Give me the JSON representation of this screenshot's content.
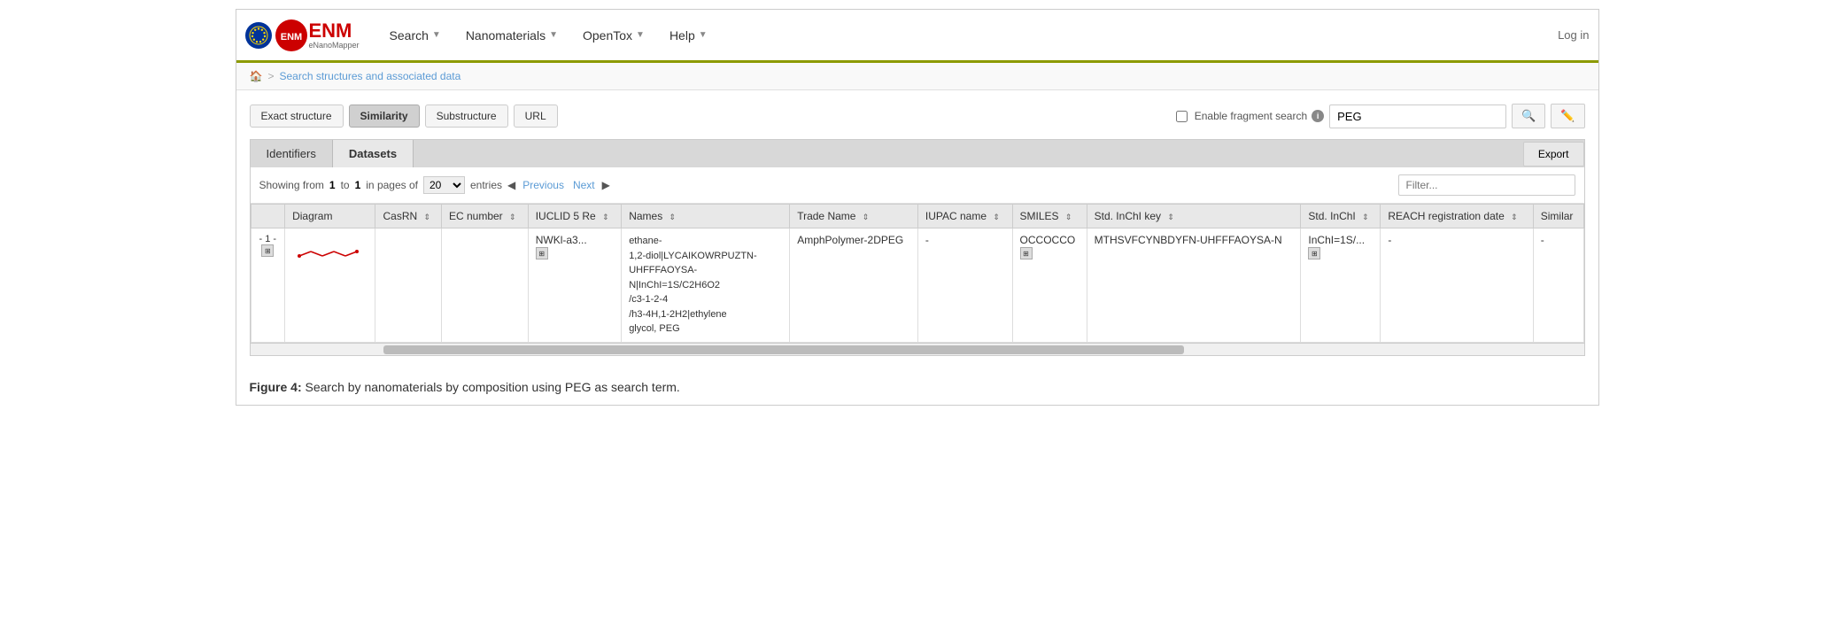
{
  "app": {
    "title": "eNanoMapper",
    "login_label": "Log in"
  },
  "navbar": {
    "items": [
      {
        "id": "search",
        "label": "Search",
        "has_dropdown": true
      },
      {
        "id": "nanomaterials",
        "label": "Nanomaterials",
        "has_dropdown": true
      },
      {
        "id": "opentox",
        "label": "OpenTox",
        "has_dropdown": true
      },
      {
        "id": "help",
        "label": "Help",
        "has_dropdown": true
      }
    ]
  },
  "breadcrumb": {
    "home_icon": "🏠",
    "separator": ">",
    "link_label": "Search structures and associated data"
  },
  "search_tabs": [
    {
      "id": "exact",
      "label": "Exact structure",
      "active": false
    },
    {
      "id": "similarity",
      "label": "Similarity",
      "active": true
    },
    {
      "id": "substructure",
      "label": "Substructure",
      "active": false
    },
    {
      "id": "url",
      "label": "URL",
      "active": false
    }
  ],
  "fragment_search": {
    "label": "Enable fragment search",
    "info_icon": "i",
    "search_value": "PEG",
    "search_placeholder": "PEG"
  },
  "id_tabs": [
    {
      "id": "identifiers",
      "label": "Identifiers",
      "active": false
    },
    {
      "id": "datasets",
      "label": "Datasets",
      "active": true
    }
  ],
  "export_label": "Export",
  "entries": {
    "showing_prefix": "Showing from",
    "from": "1",
    "to_text": "to",
    "to": "1",
    "pages_text": "in pages of",
    "page_size": "20",
    "entries_text": "entries",
    "prev_label": "Previous",
    "next_label": "Next",
    "filter_placeholder": "Filter..."
  },
  "table": {
    "columns": [
      {
        "id": "num",
        "label": ""
      },
      {
        "id": "diagram",
        "label": "Diagram"
      },
      {
        "id": "casrn",
        "label": "CasRN"
      },
      {
        "id": "ec_number",
        "label": "EC number"
      },
      {
        "id": "iuclid",
        "label": "IUCLID 5 Re"
      },
      {
        "id": "names",
        "label": "Names"
      },
      {
        "id": "trade_name",
        "label": "Trade Name"
      },
      {
        "id": "iupac_name",
        "label": "IUPAC name"
      },
      {
        "id": "smiles",
        "label": "SMILES"
      },
      {
        "id": "std_inchi_key",
        "label": "Std. InChI key"
      },
      {
        "id": "std_inchi",
        "label": "Std. InChI"
      },
      {
        "id": "reach_date",
        "label": "REACH registration date"
      },
      {
        "id": "similar",
        "label": "Similar"
      }
    ],
    "rows": [
      {
        "num": "- 1 -",
        "diagram": "molecule",
        "casrn": "",
        "ec_number": "",
        "iuclid": "NWKl-a3...",
        "names_line1": "ethane-",
        "names_line2": "1,2-diol|LYCAIKOWRPUZTN-",
        "names_line3": "UHFFFAOYSA-",
        "names_line4": "N|InChI=1S/C2H6O2",
        "names_line5": "/c3-1-2-4",
        "names_line6": "/h3-4H,1-2H2|ethylene",
        "names_line7": "glycol, PEG",
        "trade_name": "AmphPolymer-2DPEG",
        "iupac_name": "-",
        "smiles": "OCCOCCO",
        "std_inchi_key": "MTHSVFCYNBDYFN-UHFFFAOYSA-N",
        "std_inchi": "InChI=1S/...",
        "reach_date": "-",
        "similar": "-"
      }
    ]
  },
  "figure_caption": "Figure 4:",
  "figure_text": "Search by nanomaterials by composition using PEG as search term."
}
